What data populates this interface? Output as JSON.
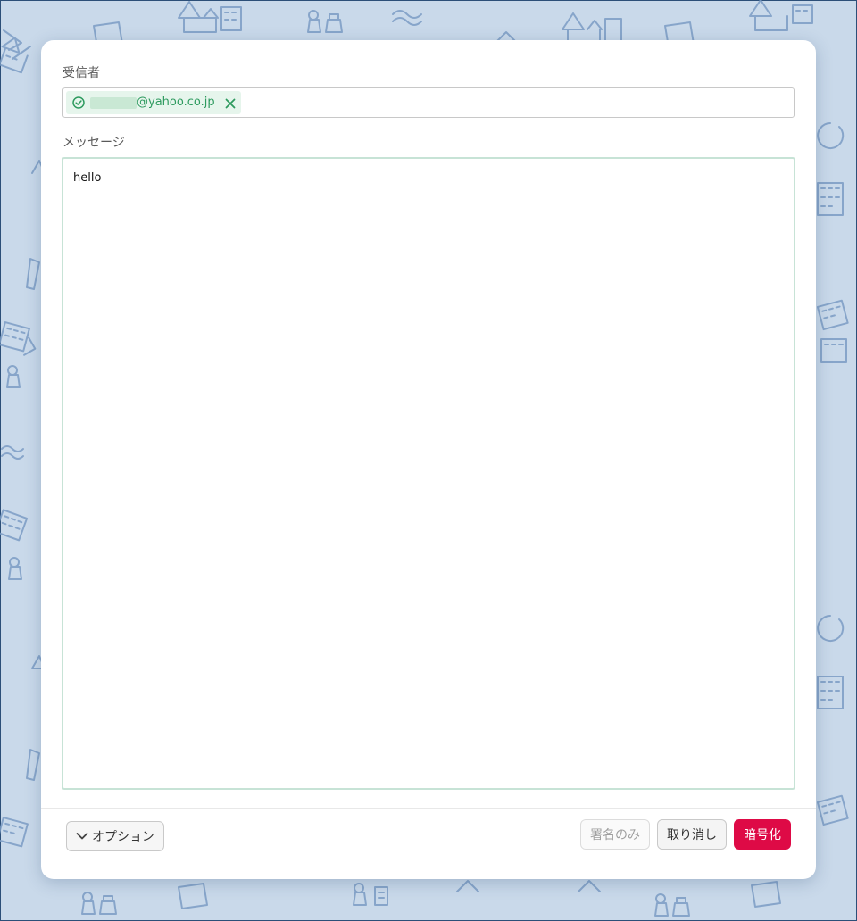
{
  "recipient": {
    "label": "受信者",
    "chip_email_suffix": "@yahoo.co.jp",
    "chip_icon": "check-circle-icon",
    "remove_icon": "close-icon"
  },
  "message": {
    "label": "メッセージ",
    "body": "hello"
  },
  "footer": {
    "options_label": "オプション",
    "options_icon": "chevron-down-icon",
    "sign_only_label": "署名のみ",
    "cancel_label": "取り消し",
    "encrypt_label": "暗号化"
  },
  "colors": {
    "background": "#c9d9ea",
    "doodle": "#7b9cc4",
    "accent_green": "#2d9a5e",
    "encrypt_button": "#de0a46"
  }
}
